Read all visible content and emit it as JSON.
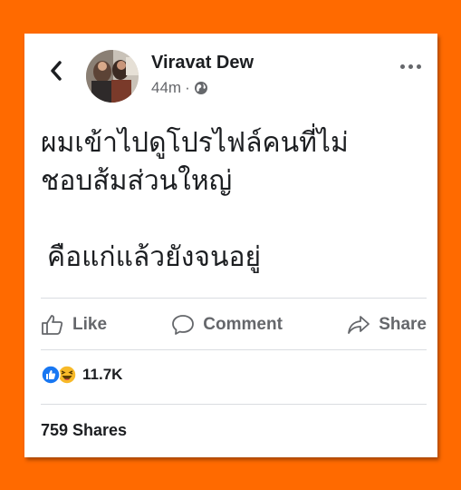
{
  "post": {
    "author": "Viravat Dew",
    "time": "44m",
    "separator": "·",
    "privacy_icon": "globe-icon",
    "text_line1": "ผมเข้าไปดูโปรไฟล์คนที่ไม่",
    "text_line2": "ชอบส้มส่วนใหญ่",
    "text_line3": "คือแก่แล้วยังจนอยู่"
  },
  "actions": {
    "like_label": "Like",
    "comment_label": "Comment",
    "share_label": "Share"
  },
  "stats": {
    "reaction_count": "11.7K",
    "reaction_icons": [
      "like-reaction-icon",
      "haha-reaction-icon"
    ],
    "shares_text": "759 Shares"
  },
  "colors": {
    "background": "#ff6a00",
    "card": "#ffffff",
    "text": "#1c1e21",
    "muted": "#65676b",
    "like_blue": "#1877f2",
    "haha_yellow": "#f7b928"
  }
}
